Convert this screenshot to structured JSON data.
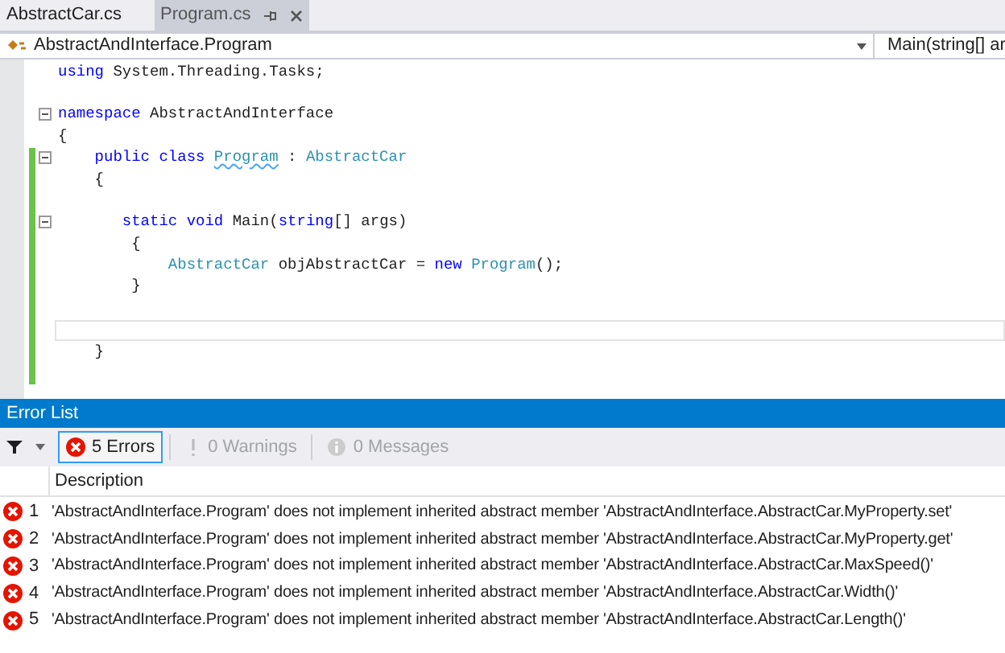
{
  "tabs": [
    {
      "label": "AbstractCar.cs",
      "selected": false
    },
    {
      "label": "Program.cs",
      "selected": true
    }
  ],
  "nav_bar": {
    "type_dropdown": "AbstractAndInterface.Program",
    "member_dropdown": "Main(string[] ar"
  },
  "code": {
    "lines": [
      {
        "tokens": [
          {
            "text": "using",
            "kind": "keyword"
          },
          {
            "text": " System.Threading.Tasks;",
            "kind": "plain"
          }
        ],
        "changed": false,
        "fold": false,
        "current": false
      },
      {
        "changed": false,
        "fold": false,
        "current": false
      },
      {
        "tokens": [
          {
            "text": "namespace",
            "kind": "keyword"
          },
          {
            "text": " AbstractAndInterface",
            "kind": "plain"
          }
        ],
        "changed": false,
        "fold": true,
        "current": false
      },
      {
        "tokens": [
          {
            "text": "{",
            "kind": "plain"
          }
        ],
        "changed": false,
        "fold": false,
        "current": false
      },
      {
        "tokens": [
          {
            "text": "    public class ",
            "kind": "keyword"
          },
          {
            "text": "Program",
            "kind": "error"
          },
          {
            "text": " : ",
            "kind": "plain"
          },
          {
            "text": "AbstractCar",
            "kind": "type"
          }
        ],
        "changed": true,
        "fold": true,
        "current": false
      },
      {
        "tokens": [
          {
            "text": "    {",
            "kind": "plain"
          }
        ],
        "changed": true,
        "fold": false,
        "current": false
      },
      {
        "changed": true,
        "fold": false,
        "current": false
      },
      {
        "tokens": [
          {
            "text": "       static void",
            "kind": "keyword"
          },
          {
            "text": " Main(",
            "kind": "plain"
          },
          {
            "text": "string",
            "kind": "keyword"
          },
          {
            "text": "[] args)",
            "kind": "plain"
          }
        ],
        "changed": true,
        "fold": true,
        "current": false
      },
      {
        "tokens": [
          {
            "text": "        {",
            "kind": "plain"
          }
        ],
        "changed": true,
        "fold": false,
        "current": false
      },
      {
        "tokens": [
          {
            "text": "            AbstractCar",
            "kind": "type"
          },
          {
            "text": " objAbstractCar = ",
            "kind": "plain"
          },
          {
            "text": "new ",
            "kind": "keyword"
          },
          {
            "text": "Program",
            "kind": "type"
          },
          {
            "text": "();",
            "kind": "plain"
          }
        ],
        "changed": true,
        "fold": false,
        "current": false
      },
      {
        "tokens": [
          {
            "text": "        }",
            "kind": "plain"
          }
        ],
        "changed": true,
        "fold": false,
        "current": false
      },
      {
        "changed": true,
        "fold": false,
        "current": false
      },
      {
        "changed": true,
        "fold": false,
        "current": true
      },
      {
        "tokens": [
          {
            "text": "    }",
            "kind": "plain"
          }
        ],
        "changed": true,
        "fold": false,
        "current": false
      },
      {
        "changed": true,
        "fold": false,
        "current": false
      }
    ]
  },
  "error_list": {
    "title": "Error List",
    "filters": [
      {
        "label": "5 Errors",
        "kind": "error",
        "selected": true,
        "disabled": false
      },
      {
        "label": "0 Warnings",
        "kind": "warning",
        "selected": false,
        "disabled": true
      },
      {
        "label": "0 Messages",
        "kind": "message",
        "selected": false,
        "disabled": true
      }
    ],
    "columns": [
      "Description"
    ],
    "rows": [
      {
        "number": "1",
        "description": "'AbstractAndInterface.Program' does not implement inherited abstract member 'AbstractAndInterface.AbstractCar.MyProperty.set'"
      },
      {
        "number": "2",
        "description": "'AbstractAndInterface.Program' does not implement inherited abstract member 'AbstractAndInterface.AbstractCar.MyProperty.get'"
      },
      {
        "number": "3",
        "description": "'AbstractAndInterface.Program' does not implement inherited abstract member 'AbstractAndInterface.AbstractCar.MaxSpeed()'"
      },
      {
        "number": "4",
        "description": "'AbstractAndInterface.Program' does not implement inherited abstract member 'AbstractAndInterface.AbstractCar.Width()'"
      },
      {
        "number": "5",
        "description": "'AbstractAndInterface.Program' does not implement inherited abstract member 'AbstractAndInterface.AbstractCar.Length()'"
      }
    ]
  }
}
